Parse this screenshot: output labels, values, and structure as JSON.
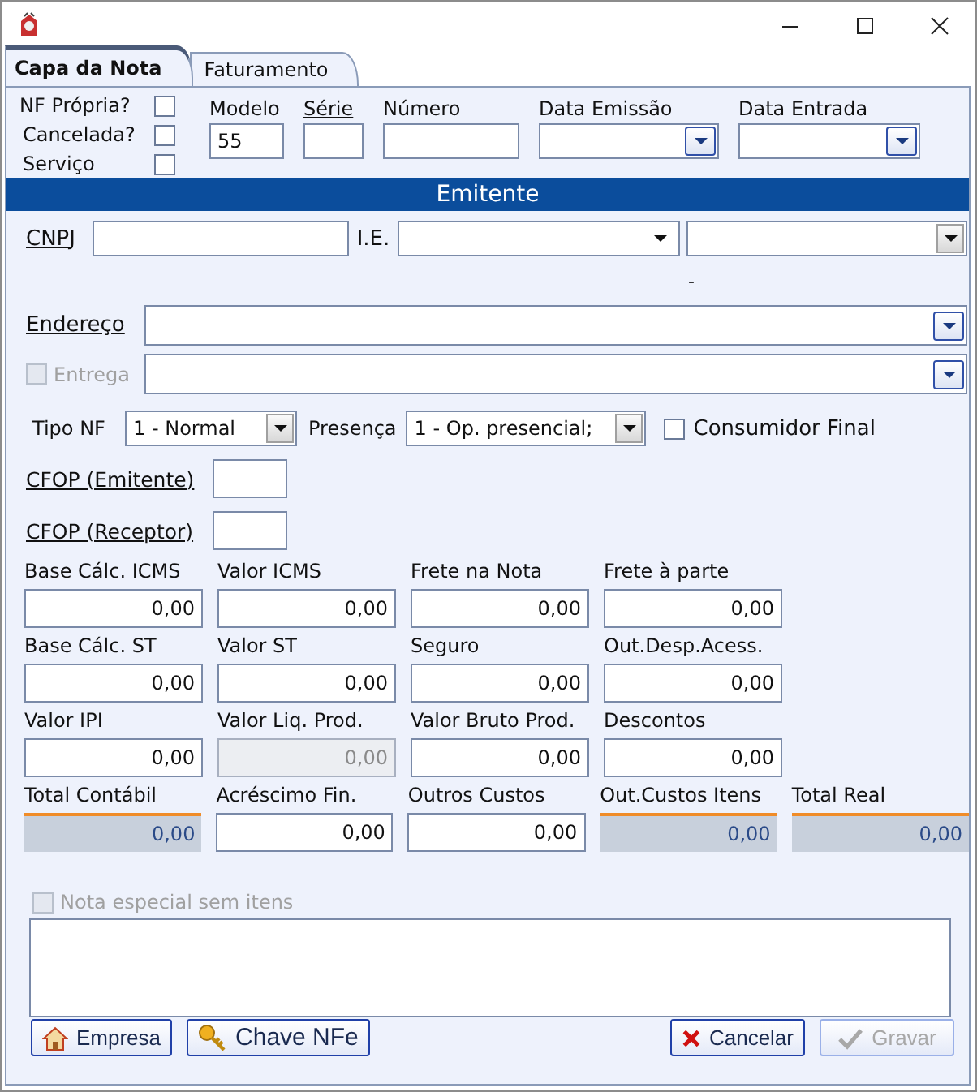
{
  "tabs": [
    {
      "label": "Capa da Nota",
      "selected": true
    },
    {
      "label": "Faturamento",
      "selected": false
    }
  ],
  "flags": [
    {
      "label": "NF Própria?",
      "checked": false
    },
    {
      "label": "Cancelada?",
      "checked": false
    },
    {
      "label": "Serviço",
      "checked": false
    }
  ],
  "header_fields": [
    {
      "label": "Modelo",
      "value": "55",
      "kind": "text",
      "underlined": false
    },
    {
      "label": "Série",
      "kind": "text",
      "underlined": true
    },
    {
      "label": "Número",
      "kind": "text",
      "underlined": false
    },
    {
      "label": "Data Emissão",
      "kind": "date",
      "underlined": false
    },
    {
      "label": "Data Entrada",
      "kind": "date",
      "underlined": false
    }
  ],
  "emitente": {
    "title": "Emitente",
    "cnpj_label": "CNPJ",
    "ie_label": "I.E.",
    "dash": "-",
    "endereco_label": "Endereço",
    "entrega": {
      "label": "Entrega",
      "checked": false,
      "disabled": true
    }
  },
  "tipo_nf": {
    "label": "Tipo NF",
    "value": "1 - Normal"
  },
  "presenca": {
    "label": "Presença",
    "value": "1 - Op. presencial;"
  },
  "consumidor_final": {
    "label": "Consumidor Final",
    "checked": false
  },
  "cfop": [
    {
      "label": "CFOP (Emitente)"
    },
    {
      "label": "CFOP (Receptor)"
    }
  ],
  "totals": [
    [
      {
        "label": "Base Cálc. ICMS",
        "value": "0,00",
        "kind": "input"
      },
      {
        "label": "Valor ICMS",
        "value": "0,00",
        "kind": "input"
      },
      {
        "label": "Frete na Nota",
        "value": "0,00",
        "kind": "input"
      },
      {
        "label": "Frete à parte",
        "value": "0,00",
        "kind": "input"
      }
    ],
    [
      {
        "label": "Base Cálc. ST",
        "value": "0,00",
        "kind": "input"
      },
      {
        "label": "Valor ST",
        "value": "0,00",
        "kind": "input"
      },
      {
        "label": "Seguro",
        "value": "0,00",
        "kind": "input"
      },
      {
        "label": "Out.Desp.Acess.",
        "value": "0,00",
        "kind": "input"
      }
    ],
    [
      {
        "label": "Valor IPI",
        "value": "0,00",
        "kind": "input"
      },
      {
        "label": "Valor Liq. Prod.",
        "value": "0,00",
        "kind": "disabled"
      },
      {
        "label": "Valor Bruto Prod.",
        "value": "0,00",
        "kind": "input"
      },
      {
        "label": "Descontos",
        "value": "0,00",
        "kind": "input"
      }
    ],
    [
      {
        "label": "Total Contábil",
        "value": "0,00",
        "kind": "readonly"
      },
      {
        "label": "Acréscimo Fin.",
        "value": "0,00",
        "kind": "input"
      },
      {
        "label": "Outros Custos",
        "value": "0,00",
        "kind": "input"
      },
      {
        "label": "Out.Custos Itens",
        "value": "0,00",
        "kind": "readonly"
      },
      {
        "label": "Total Real",
        "value": "0,00",
        "kind": "readonly"
      }
    ]
  ],
  "nota_especial": {
    "label": "Nota especial sem itens",
    "checked": false,
    "disabled": true
  },
  "buttons_left": [
    {
      "label": "Empresa",
      "kind": "house",
      "disabled": false
    },
    {
      "label": "Chave NFe",
      "kind": "key",
      "disabled": false
    }
  ],
  "buttons_right": [
    {
      "label": "Cancelar",
      "kind": "cross",
      "disabled": false
    },
    {
      "label": "Gravar",
      "kind": "check",
      "disabled": true
    }
  ]
}
